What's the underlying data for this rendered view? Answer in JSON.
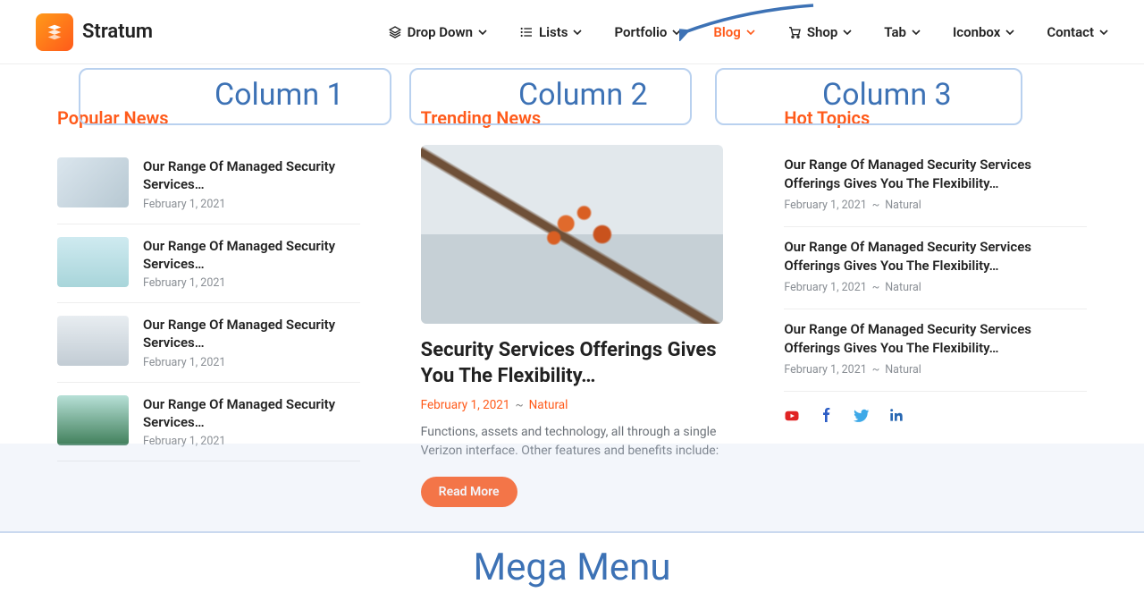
{
  "brand": {
    "name": "Stratum"
  },
  "nav": {
    "items": [
      {
        "label": "Drop Down",
        "icon": "layers-icon"
      },
      {
        "label": "Lists",
        "icon": "list-icon"
      },
      {
        "label": "Portfolio",
        "icon": null
      },
      {
        "label": "Blog",
        "icon": null,
        "active": true
      },
      {
        "label": "Shop",
        "icon": "cart-icon"
      },
      {
        "label": "Tab",
        "icon": null
      },
      {
        "label": "Iconbox",
        "icon": null
      },
      {
        "label": "Contact",
        "icon": null
      }
    ]
  },
  "annotations": {
    "col1": "Column 1",
    "col2": "Column 2",
    "col3": "Column 3",
    "mega": "Mega Menu"
  },
  "columns": {
    "popular": {
      "title": "Popular News",
      "items": [
        {
          "title": "Our Range Of Managed Security Services…",
          "date": "February 1, 2021"
        },
        {
          "title": "Our Range Of Managed Security Services…",
          "date": "February 1, 2021"
        },
        {
          "title": "Our Range Of Managed Security Services…",
          "date": "February 1, 2021"
        },
        {
          "title": "Our Range Of Managed Security Services…",
          "date": "February 1, 2021"
        }
      ]
    },
    "trending": {
      "title": "Trending News",
      "featured": {
        "title": "Security Services Offerings Gives You The Flexibility…",
        "date": "February 1, 2021",
        "category": "Natural",
        "excerpt": "Functions, assets and technology, all through a single Verizon interface. Other features and benefits include:",
        "button": "Read More"
      }
    },
    "hot": {
      "title": "Hot Topics",
      "items": [
        {
          "title": "Our Range Of Managed Security Services Offerings Gives You The Flexibility…",
          "date": "February 1, 2021",
          "category": "Natural"
        },
        {
          "title": "Our Range Of Managed Security Services Offerings Gives You The Flexibility…",
          "date": "February 1, 2021",
          "category": "Natural"
        },
        {
          "title": "Our Range Of Managed Security Services Offerings Gives You The Flexibility…",
          "date": "February 1, 2021",
          "category": "Natural"
        }
      ]
    }
  },
  "socials": [
    "youtube",
    "facebook",
    "twitter",
    "linkedin"
  ]
}
